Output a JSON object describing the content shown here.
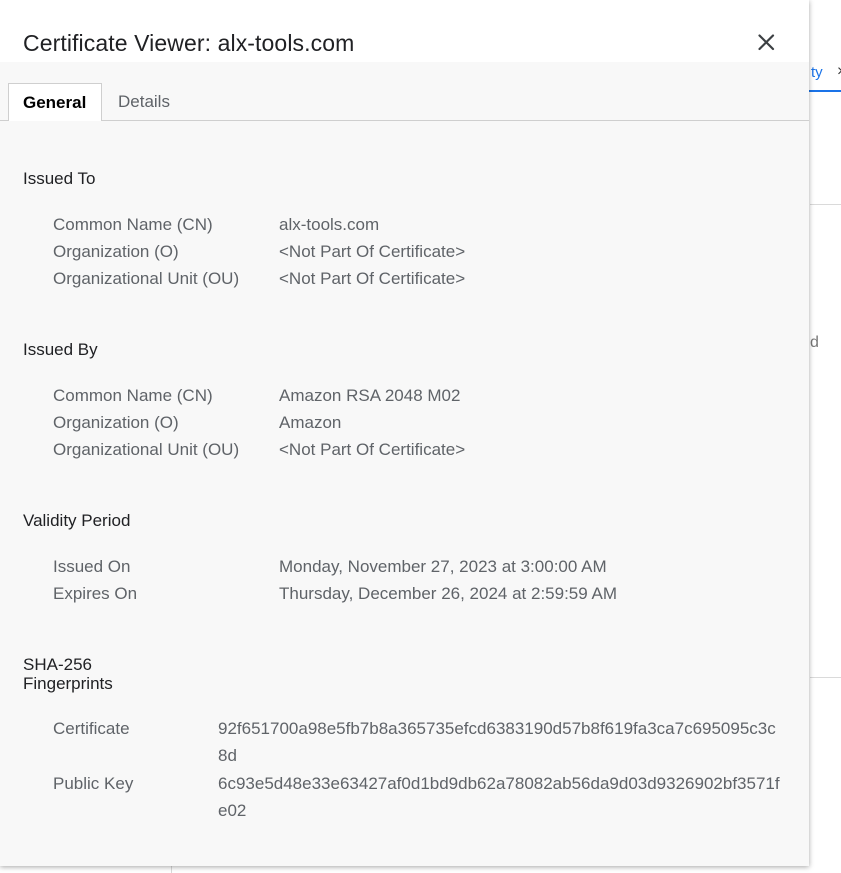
{
  "background": {
    "tab_label": "ty",
    "tab_close": "×",
    "text_fragment": "d"
  },
  "dialog": {
    "title": "Certificate Viewer: alx-tools.com",
    "close_glyph": "close"
  },
  "tabs": [
    {
      "label": "General",
      "active": true
    },
    {
      "label": "Details",
      "active": false
    }
  ],
  "issued_to": {
    "title": "Issued To",
    "rows": [
      {
        "label": "Common Name (CN)",
        "value": "alx-tools.com"
      },
      {
        "label": "Organization (O)",
        "value": "<Not Part Of Certificate>"
      },
      {
        "label": "Organizational Unit (OU)",
        "value": "<Not Part Of Certificate>"
      }
    ]
  },
  "issued_by": {
    "title": "Issued By",
    "rows": [
      {
        "label": "Common Name (CN)",
        "value": "Amazon RSA 2048 M02"
      },
      {
        "label": "Organization (O)",
        "value": "Amazon"
      },
      {
        "label": "Organizational Unit (OU)",
        "value": "<Not Part Of Certificate>"
      }
    ]
  },
  "validity": {
    "title": "Validity Period",
    "rows": [
      {
        "label": "Issued On",
        "value": "Monday, November 27, 2023 at 3:00:00 AM"
      },
      {
        "label": "Expires On",
        "value": "Thursday, December 26, 2024 at 2:59:59 AM"
      }
    ]
  },
  "fingerprints": {
    "title_line1": "SHA-256",
    "title_line2": "Fingerprints",
    "rows": [
      {
        "label": "Certificate",
        "value": "92f651700a98e5fb7b8a365735efcd6383190d57b8f619fa3ca7c695095c3c8d"
      },
      {
        "label": "Public Key",
        "value": "6c93e5d48e33e63427af0d1bd9db62a78082ab56da9d03d9326902bf3571fe02"
      }
    ]
  },
  "colors": {
    "accent": "#1a73e8",
    "dialog_bg": "#f8f8f8",
    "header_bg": "#ffffff",
    "label_text": "#5f6368",
    "title_text": "#202124"
  }
}
